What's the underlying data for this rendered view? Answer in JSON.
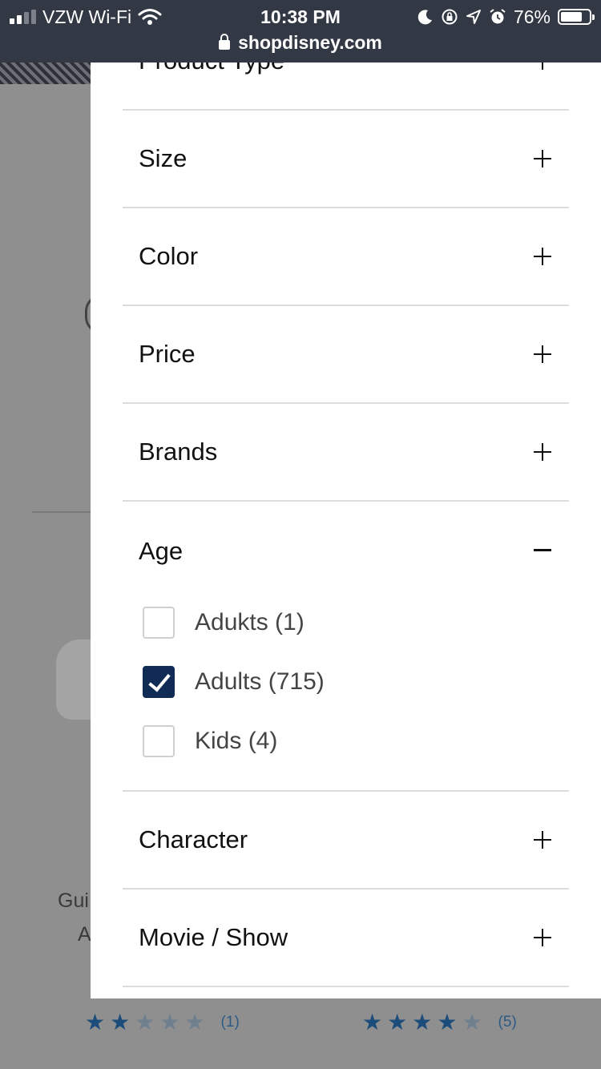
{
  "status_bar": {
    "carrier": "VZW Wi-Fi",
    "time": "10:38 PM",
    "battery": "76%",
    "battery_level": 0.76,
    "url": "shopdisney.com"
  },
  "background": {
    "product_left_title": "Gui",
    "product_left_subtitle": "A",
    "ratings": [
      {
        "stars_filled": 2,
        "stars_total": 5,
        "count": "(1)"
      },
      {
        "stars_filled": 4,
        "stars_total": 5,
        "count": "(5)"
      }
    ]
  },
  "filters": {
    "sections": {
      "product_type": {
        "label": "Product Type",
        "state": "collapsed"
      },
      "size": {
        "label": "Size",
        "state": "collapsed"
      },
      "color": {
        "label": "Color",
        "state": "collapsed"
      },
      "price": {
        "label": "Price",
        "state": "collapsed"
      },
      "brands": {
        "label": "Brands",
        "state": "collapsed"
      },
      "age": {
        "label": "Age",
        "state": "expanded"
      },
      "character": {
        "label": "Character",
        "state": "collapsed"
      },
      "movie_show": {
        "label": "Movie / Show",
        "state": "collapsed"
      }
    },
    "age_options": [
      {
        "label": "Adukts (1)",
        "checked": false
      },
      {
        "label": "Adults (715)",
        "checked": true
      },
      {
        "label": "Kids (4)",
        "checked": false
      }
    ]
  }
}
